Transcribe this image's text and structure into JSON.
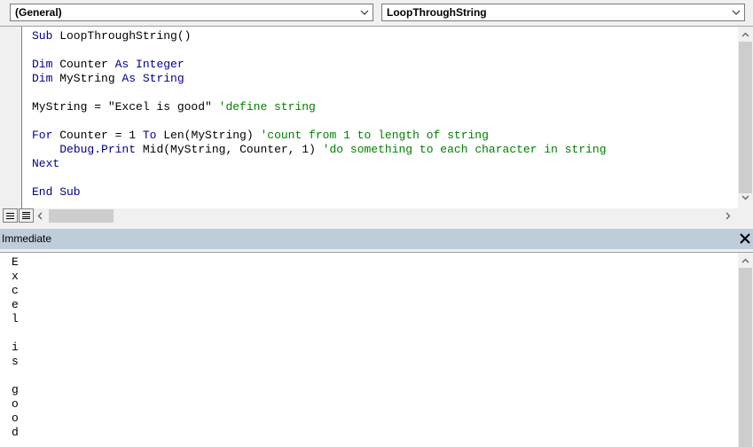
{
  "toolbar": {
    "object_combo": {
      "value": "(General)"
    },
    "procedure_combo": {
      "value": "LoopThroughString"
    }
  },
  "code": {
    "lines": [
      [
        {
          "t": "kw",
          "v": "Sub"
        },
        {
          "t": "tx",
          "v": " LoopThroughString()"
        }
      ],
      [],
      [
        {
          "t": "kw",
          "v": "Dim"
        },
        {
          "t": "tx",
          "v": " Counter "
        },
        {
          "t": "kw",
          "v": "As"
        },
        {
          "t": "tx",
          "v": " "
        },
        {
          "t": "kw",
          "v": "Integer"
        }
      ],
      [
        {
          "t": "kw",
          "v": "Dim"
        },
        {
          "t": "tx",
          "v": " MyString "
        },
        {
          "t": "kw",
          "v": "As"
        },
        {
          "t": "tx",
          "v": " "
        },
        {
          "t": "kw",
          "v": "String"
        }
      ],
      [],
      [
        {
          "t": "tx",
          "v": "MyString = \"Excel is good\" "
        },
        {
          "t": "cm",
          "v": "'define string"
        }
      ],
      [],
      [
        {
          "t": "kw",
          "v": "For"
        },
        {
          "t": "tx",
          "v": " Counter = 1 "
        },
        {
          "t": "kw",
          "v": "To"
        },
        {
          "t": "tx",
          "v": " Len(MyString) "
        },
        {
          "t": "cm",
          "v": "'count from 1 to length of string"
        }
      ],
      [
        {
          "t": "tx",
          "v": "    "
        },
        {
          "t": "kw",
          "v": "Debug.Print"
        },
        {
          "t": "tx",
          "v": " Mid(MyString, Counter, 1) "
        },
        {
          "t": "cm",
          "v": "'do something to each character in string"
        }
      ],
      [
        {
          "t": "kw",
          "v": "Next"
        }
      ],
      [],
      [
        {
          "t": "kw",
          "v": "End Sub"
        }
      ]
    ]
  },
  "immediate": {
    "title": "Immediate",
    "output": [
      "E",
      "x",
      "c",
      "e",
      "l",
      "",
      "i",
      "s",
      "",
      "g",
      "o",
      "o",
      "d"
    ]
  },
  "colors": {
    "keyword": "#00008b",
    "comment": "#008000",
    "header_bg": "#bfcddb"
  },
  "icons": {
    "combo_arrow": "chevron-down-icon",
    "close": "close-icon",
    "procedure_view": "procedure-view-icon",
    "full_module_view": "full-module-view-icon"
  }
}
